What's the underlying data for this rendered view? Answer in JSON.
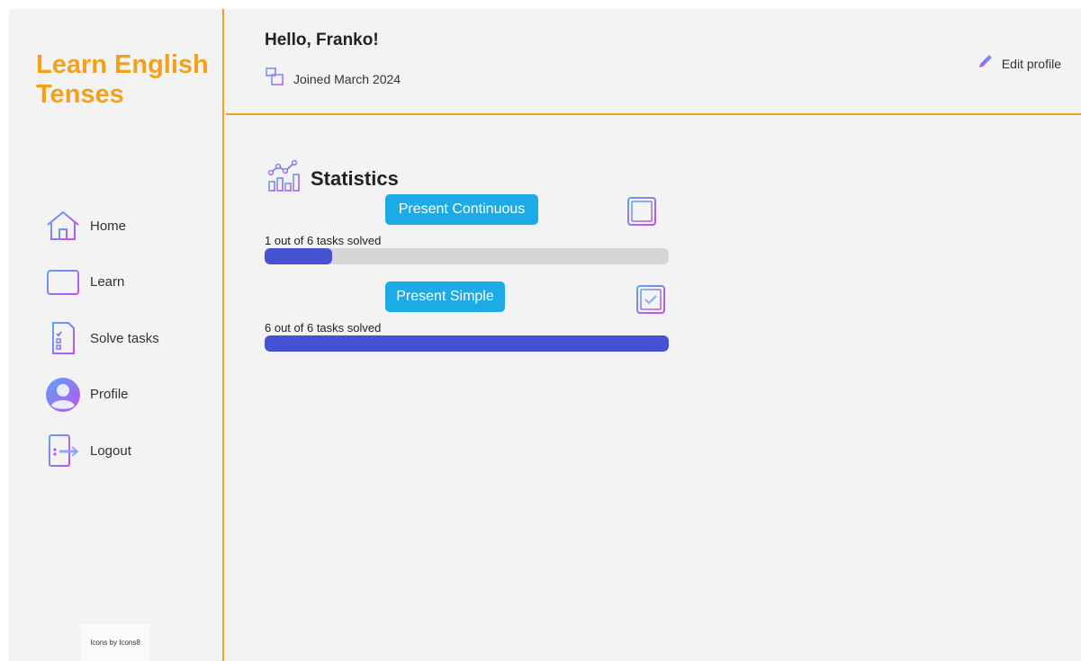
{
  "app": {
    "title": "Learn English Tenses"
  },
  "sidebar": {
    "items": [
      {
        "label": "Home",
        "icon": "home-icon"
      },
      {
        "label": "Learn",
        "icon": "book-icon"
      },
      {
        "label": "Solve tasks",
        "icon": "checklist-icon"
      },
      {
        "label": "Profile",
        "icon": "user-avatar-icon"
      },
      {
        "label": "Logout",
        "icon": "logout-door-icon"
      }
    ],
    "credit": "Icons by Icons8"
  },
  "header": {
    "greeting": "Hello, Franko!",
    "joined": "Joined March 2024",
    "edit_label": "Edit profile"
  },
  "statistics": {
    "title": "Statistics",
    "tenses": [
      {
        "name": "Present Continuous",
        "status_text": "1 out of 6 tasks solved",
        "solved": 1,
        "total": 6,
        "completed": false
      },
      {
        "name": "Present Simple",
        "status_text": "6 out of 6 tasks solved",
        "solved": 6,
        "total": 6,
        "completed": true
      }
    ]
  },
  "colors": {
    "brand": "#f3a11c",
    "accent_line": "#f0a020",
    "badge": "#1cabe6",
    "progress_fill": "#4553d3",
    "progress_track": "#d6d6d6",
    "icon_gradient_start": "#5aa6f5",
    "icon_gradient_end": "#c04ef0"
  }
}
